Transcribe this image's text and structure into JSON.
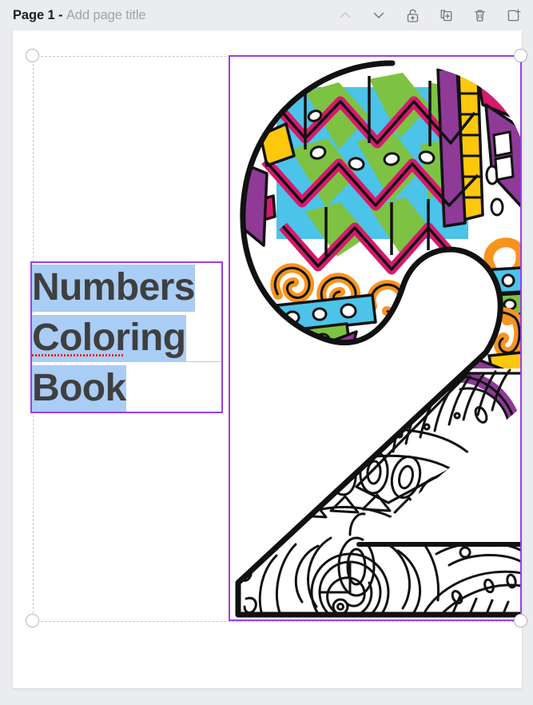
{
  "topbar": {
    "page_prefix": "Page 1 - ",
    "page_title_placeholder": "Add page title",
    "buttons": [
      {
        "name": "move-page-up",
        "icon": "chevron-up-icon",
        "label": "Move page up",
        "disabled": true
      },
      {
        "name": "move-page-down",
        "icon": "chevron-down-icon",
        "label": "Move page down",
        "disabled": false
      },
      {
        "name": "lock-page",
        "icon": "unlock-icon",
        "label": "Lock page",
        "disabled": false
      },
      {
        "name": "duplicate-page",
        "icon": "duplicate-icon",
        "label": "Duplicate page",
        "disabled": false
      },
      {
        "name": "delete-page",
        "icon": "trash-icon",
        "label": "Delete page",
        "disabled": false
      },
      {
        "name": "add-page",
        "icon": "add-page-icon",
        "label": "Add page",
        "disabled": false
      }
    ]
  },
  "canvas": {
    "page_number": "1",
    "background_color": "#ffffff",
    "app_background_color": "#ebecef",
    "guide_color": "#c6c8cc",
    "selection_color": "#9b3df0",
    "text_highlight_color": "#a9cdf4",
    "spellcheck_color": "#e8202a"
  },
  "text_element": {
    "lines": [
      "Numbers",
      "Coloring",
      "Book"
    ],
    "full_text": "Numbers Coloring Book",
    "font_color": "#3f3f3f",
    "selected": true,
    "misspelled_word": "Coloring"
  },
  "image_element": {
    "alt": "Decorative patterned number two coloring page illustration",
    "selected": true,
    "palette": {
      "outline": "#111111",
      "magenta": "#d6196e",
      "green": "#7dc242",
      "cyan": "#4cc3e8",
      "orange": "#f7941e",
      "purple": "#8e3a96",
      "yellow": "#fdc70c",
      "white": "#ffffff"
    }
  },
  "handles": [
    {
      "name": "handle-top-left"
    },
    {
      "name": "handle-top-right"
    },
    {
      "name": "handle-bottom-left"
    },
    {
      "name": "handle-bottom-right"
    }
  ]
}
